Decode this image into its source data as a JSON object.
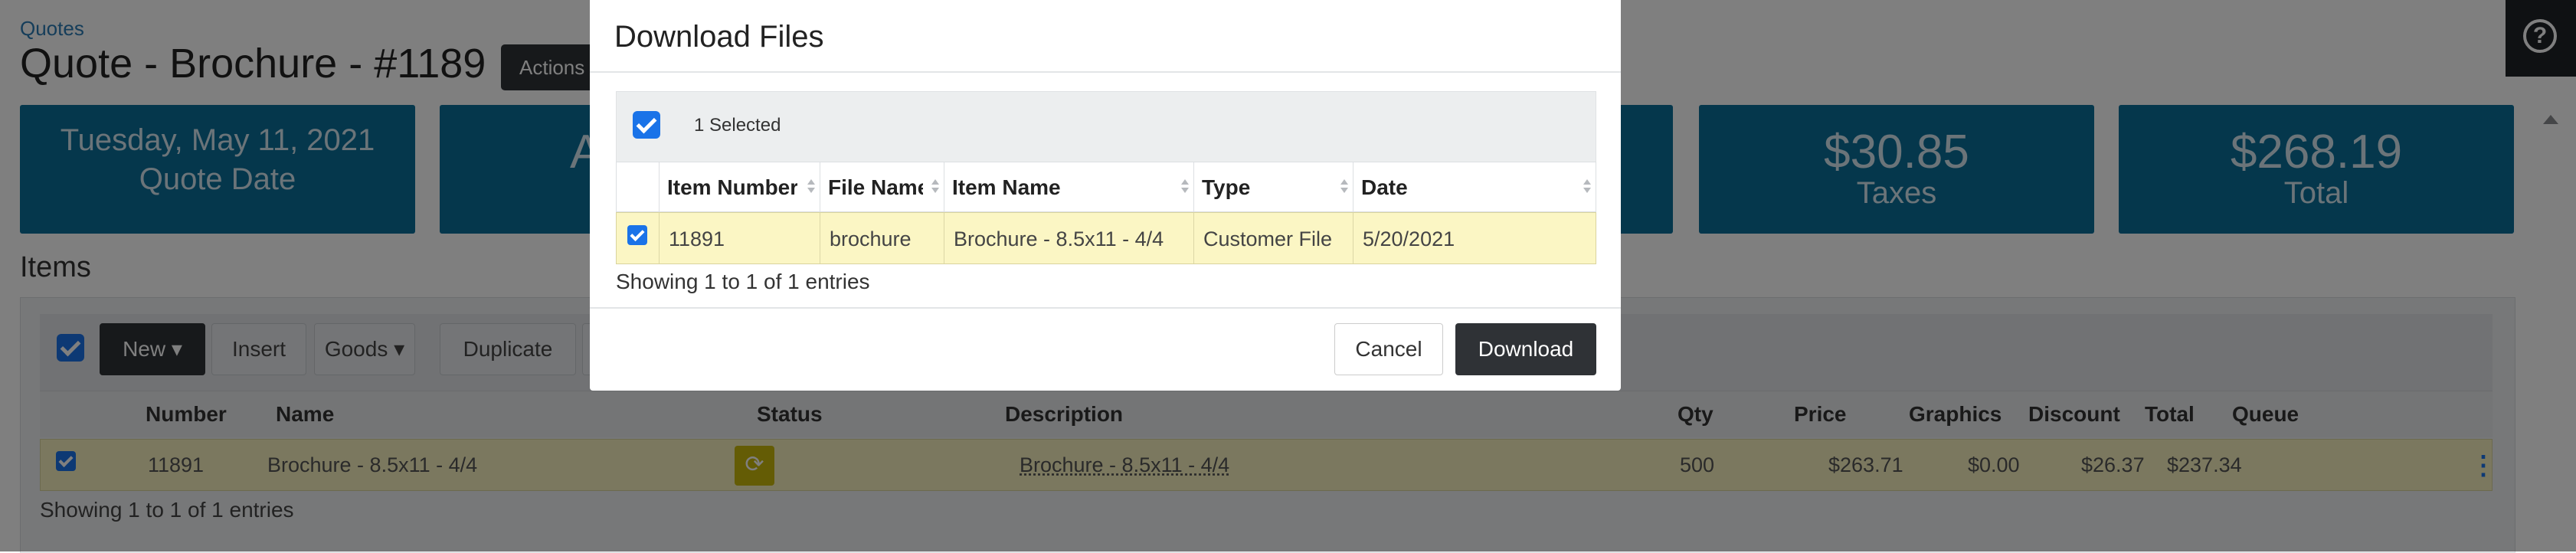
{
  "page": {
    "breadcrumb": "Quotes",
    "title": "Quote - Brochure - #1189",
    "actions_label": "Actions",
    "help_icon": "?"
  },
  "stats": [
    {
      "value": "Tuesday, May 11, 2021",
      "label": "Quote Date"
    },
    {
      "value": "A",
      "label": ""
    },
    {
      "value": "$30.85",
      "label": "Taxes"
    },
    {
      "value": "$268.19",
      "label": "Total"
    }
  ],
  "items": {
    "section_title": "Items",
    "toolbar": {
      "new_label": "New",
      "insert_label": "Insert",
      "goods_label": "Goods",
      "duplicate_label": "Duplicate"
    },
    "columns": [
      "Number",
      "Name",
      "Status",
      "Description",
      "Qty",
      "Price",
      "Graphics",
      "Discount",
      "Total",
      "Queue"
    ],
    "rows": [
      {
        "number": "11891",
        "name": "Brochure - 8.5x11 - 4/4",
        "description": "Brochure - 8.5x11 - 4/4",
        "qty": "500",
        "price": "$263.71",
        "graphics": "$0.00",
        "discount": "$26.37",
        "total": "$237.34"
      }
    ],
    "showing": "Showing 1 to 1 of 1 entries"
  },
  "modal": {
    "title": "Download Files",
    "selected_text": "1 Selected",
    "columns": [
      "Item Number",
      "File Name",
      "Item Name",
      "Type",
      "Date"
    ],
    "rows": [
      {
        "item_number": "11891",
        "file_name": "brochure",
        "item_name": "Brochure - 8.5x11 - 4/4",
        "type": "Customer File",
        "date": "5/20/2021"
      }
    ],
    "showing": "Showing 1 to 1 of 1 entries",
    "cancel_label": "Cancel",
    "download_label": "Download"
  },
  "colors": {
    "stat_bg": "#0b6f99",
    "dark_button": "#2f3236",
    "selected_row": "#fbf6c4",
    "checkbox": "#1a73e8"
  }
}
